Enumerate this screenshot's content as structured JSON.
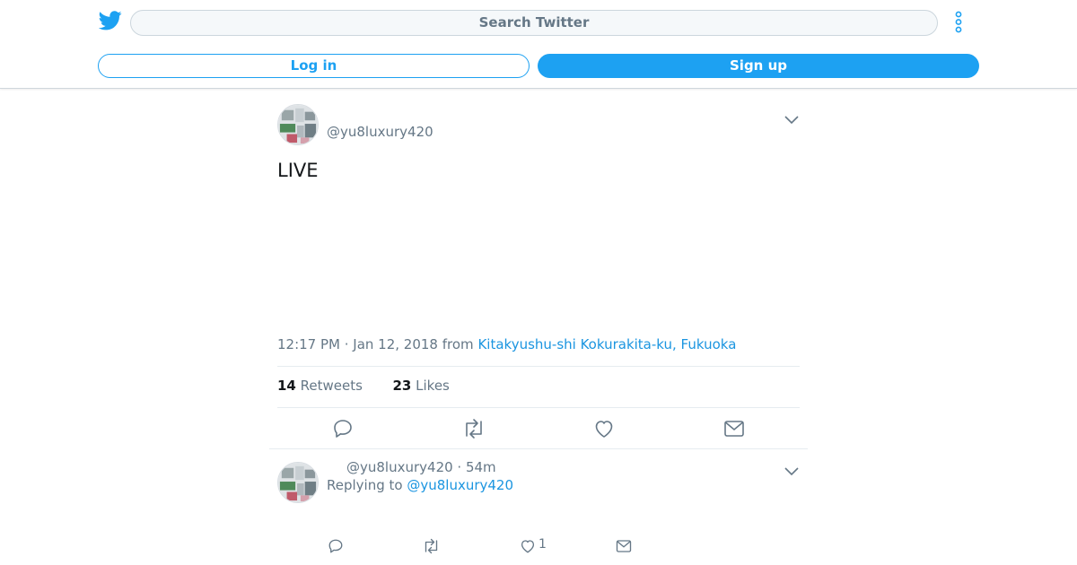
{
  "header": {
    "search_placeholder": "Search Twitter",
    "login_label": "Log in",
    "signup_label": "Sign up",
    "accent_color": "#1da1f2"
  },
  "tweet": {
    "handle": "@yu8luxury420",
    "text": "LIVE",
    "timestamp": "12:17 PM · Jan 12, 2018",
    "from_label": "from",
    "location": "Kitakyushu-shi Kokurakita-ku, Fukuoka",
    "retweets_count": "14",
    "retweets_label": "Retweets",
    "likes_count": "23",
    "likes_label": "Likes"
  },
  "reply": {
    "handle_time": "@yu8luxury420 · 54m",
    "replying_label": "Replying to",
    "replying_handle": "@yu8luxury420",
    "like_count": "1"
  },
  "icons": {
    "logo": "twitter-bird-icon",
    "more": "more-vertical-icon",
    "caret": "chevron-down-icon",
    "reply": "reply-icon",
    "retweet": "retweet-icon",
    "like": "heart-icon",
    "message": "envelope-icon"
  }
}
